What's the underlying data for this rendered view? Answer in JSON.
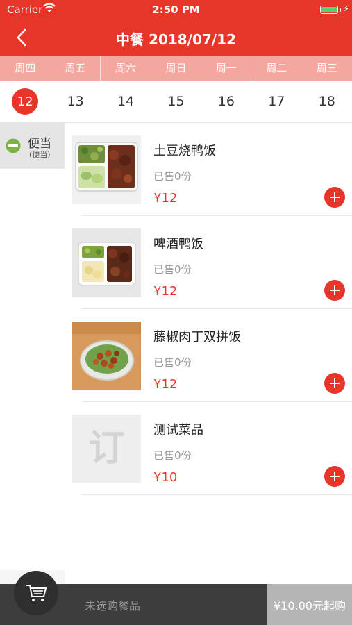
{
  "status_bar": {
    "carrier": "Carrier",
    "time": "2:50 PM"
  },
  "nav": {
    "title": "中餐 2018/07/12"
  },
  "weekdays": [
    "周四",
    "周五",
    "周六",
    "周日",
    "周一",
    "周二",
    "周三"
  ],
  "dates": [
    "12",
    "13",
    "14",
    "15",
    "16",
    "17",
    "18"
  ],
  "selected_date": "12",
  "category": {
    "name": "便当",
    "sub": "(便当)"
  },
  "dishes": [
    {
      "name": "土豆烧鸭饭",
      "sold": "已售0份",
      "price": "¥12"
    },
    {
      "name": "啤酒鸭饭",
      "sold": "已售0份",
      "price": "¥12"
    },
    {
      "name": "藤椒肉丁双拼饭",
      "sold": "已售0份",
      "price": "¥12"
    },
    {
      "name": "测试菜品",
      "sold": "已售0份",
      "price": "¥10"
    }
  ],
  "placeholder_glyph": "订",
  "cart": {
    "status": "未选购餐品",
    "checkout": "¥10.00元起购"
  },
  "colors": {
    "accent": "#e8352a",
    "weekday_bar": "#f4a79f",
    "bottom_bar": "#3d3d3d",
    "checkout_bg": "#b5b5b5"
  }
}
